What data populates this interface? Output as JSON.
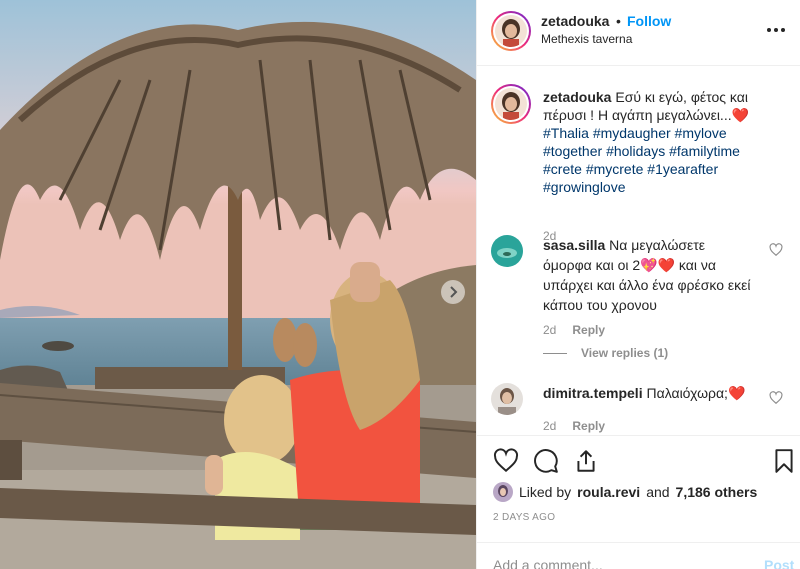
{
  "post": {
    "photo_alt": "Mother and daughter sitting under a palm-leaf umbrella by the sea at sunset",
    "next_icon": "chevron-right-icon"
  },
  "header": {
    "username": "zetadouka",
    "dot": "•",
    "follow_label": "Follow",
    "location": "Methexis taverna",
    "more_icon": "more-horizontal-icon"
  },
  "caption": {
    "username": "zetadouka",
    "text": "Εσύ κι εγώ, φέτος και πέρυσι ! Η αγάπη μεγαλώνει...",
    "emoji": "❤️",
    "hashtags": [
      "#Thalia",
      "#mydaugher",
      "#mylove",
      "#together",
      "#holidays",
      "#familytime",
      "#crete",
      "#mycrete",
      "#1yearafter",
      "#growinglove"
    ],
    "time": "2d"
  },
  "comments": [
    {
      "username": "sasa.silla",
      "text": "Να μεγαλώσετε όμορφα και οι 2💖❤️ και να υπάρχει και άλλο ένα φρέσκο εκεί κάπου του χρονου",
      "time": "2d",
      "reply_label": "Reply",
      "view_replies": "View replies (1)"
    },
    {
      "username": "dimitra.tempeli",
      "text": "Παλαιόχωρα;❤️",
      "time": "2d",
      "reply_label": "Reply"
    }
  ],
  "actions": {
    "like_icon": "heart-outline-icon",
    "comment_icon": "comment-icon",
    "share_icon": "share-icon",
    "save_icon": "bookmark-icon",
    "liked_by_prefix": "Liked by",
    "liked_by_user": "roula.revi",
    "liked_by_and": "and",
    "liked_by_others": "7,186 others",
    "date": "2 DAYS AGO"
  },
  "add_comment": {
    "placeholder": "Add a comment...",
    "post_label": "Post"
  },
  "colors": {
    "accent": "#0095f6",
    "hashtag": "#00376b",
    "muted": "#8e8e8e",
    "post_disabled": "#b2dffc"
  }
}
